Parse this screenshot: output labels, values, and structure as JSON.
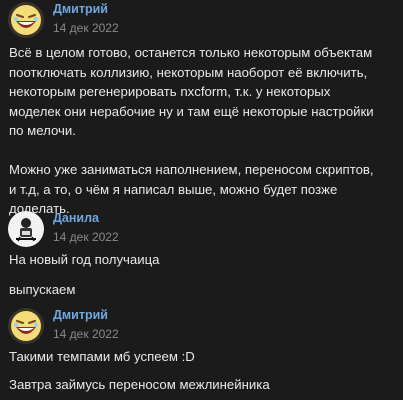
{
  "messages": [
    {
      "author": "Дмитрий",
      "time": "14 дек 2022",
      "avatar": "laughing-emoji-avatar",
      "lines": [
        "Всё в целом готово, останется только некоторым объектам",
        "поотключать коллизию, некоторым наоборот её включить,",
        "некоторым регенерировать nxcform, т.к. у некоторых",
        "моделек они нерабочие ну и там ещё некоторые настройки",
        "по мелочи.",
        "",
        "Можно уже заниматься наполнением, переносом скриптов,",
        "и т.д, а то, о чём я написал выше, можно будет позже",
        "доделать."
      ]
    },
    {
      "author": "Данила",
      "time": "14 дек 2022",
      "avatar": "sketch-person-avatar",
      "lines": [
        "На новый год получаица"
      ],
      "extra": "выпускаем"
    },
    {
      "author": "Дмитрий",
      "time": "14 дек 2022",
      "avatar": "laughing-emoji-avatar",
      "lines": [
        "Такими темпами мб успеем :D"
      ],
      "extra": "Завтра займусь переносом межлинейника"
    }
  ],
  "colors": {
    "background": "#1b1b1b",
    "author": "#71a7e0",
    "time": "#8a8a8a",
    "text": "#e9e9e9"
  }
}
